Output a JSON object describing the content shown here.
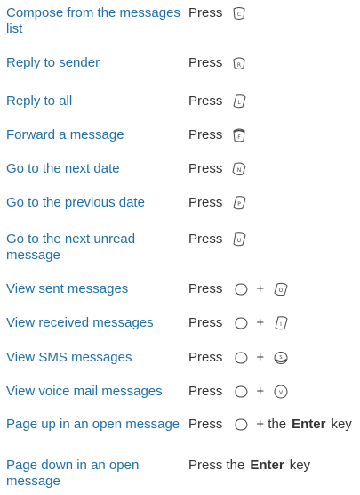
{
  "rows": [
    {
      "action": "Compose from the messages list",
      "press": "Press",
      "key": "C"
    },
    {
      "action": "Reply to sender",
      "press": "Press",
      "key": "R"
    },
    {
      "action": "Reply to all",
      "press": "Press",
      "key": "L"
    },
    {
      "action": "Forward a message",
      "press": "Press",
      "key": "F"
    },
    {
      "action": "Go to the next date",
      "press": "Press",
      "key": "N"
    },
    {
      "action": "Go to the previous date",
      "press": "Press",
      "key": "P"
    },
    {
      "action": "Go to the next unread message",
      "press": "Press",
      "key": "U"
    },
    {
      "action": "View sent messages",
      "press": "Press",
      "plus": "+",
      "key": "O"
    },
    {
      "action": "View received messages",
      "press": "Press",
      "plus": "+",
      "key": "I"
    },
    {
      "action": "View SMS messages",
      "press": "Press",
      "plus": "+",
      "key": "S"
    },
    {
      "action": "View voice mail messages",
      "press": "Press",
      "plus": "+",
      "key": "V"
    },
    {
      "action": "Page up in an open message",
      "press": "Press",
      "plus_the": "+ the",
      "enter": "Enter",
      "key_word": "key"
    },
    {
      "action": "Page down in an open message",
      "press_the": "Press the",
      "enter": "Enter",
      "key_word": "key"
    }
  ]
}
